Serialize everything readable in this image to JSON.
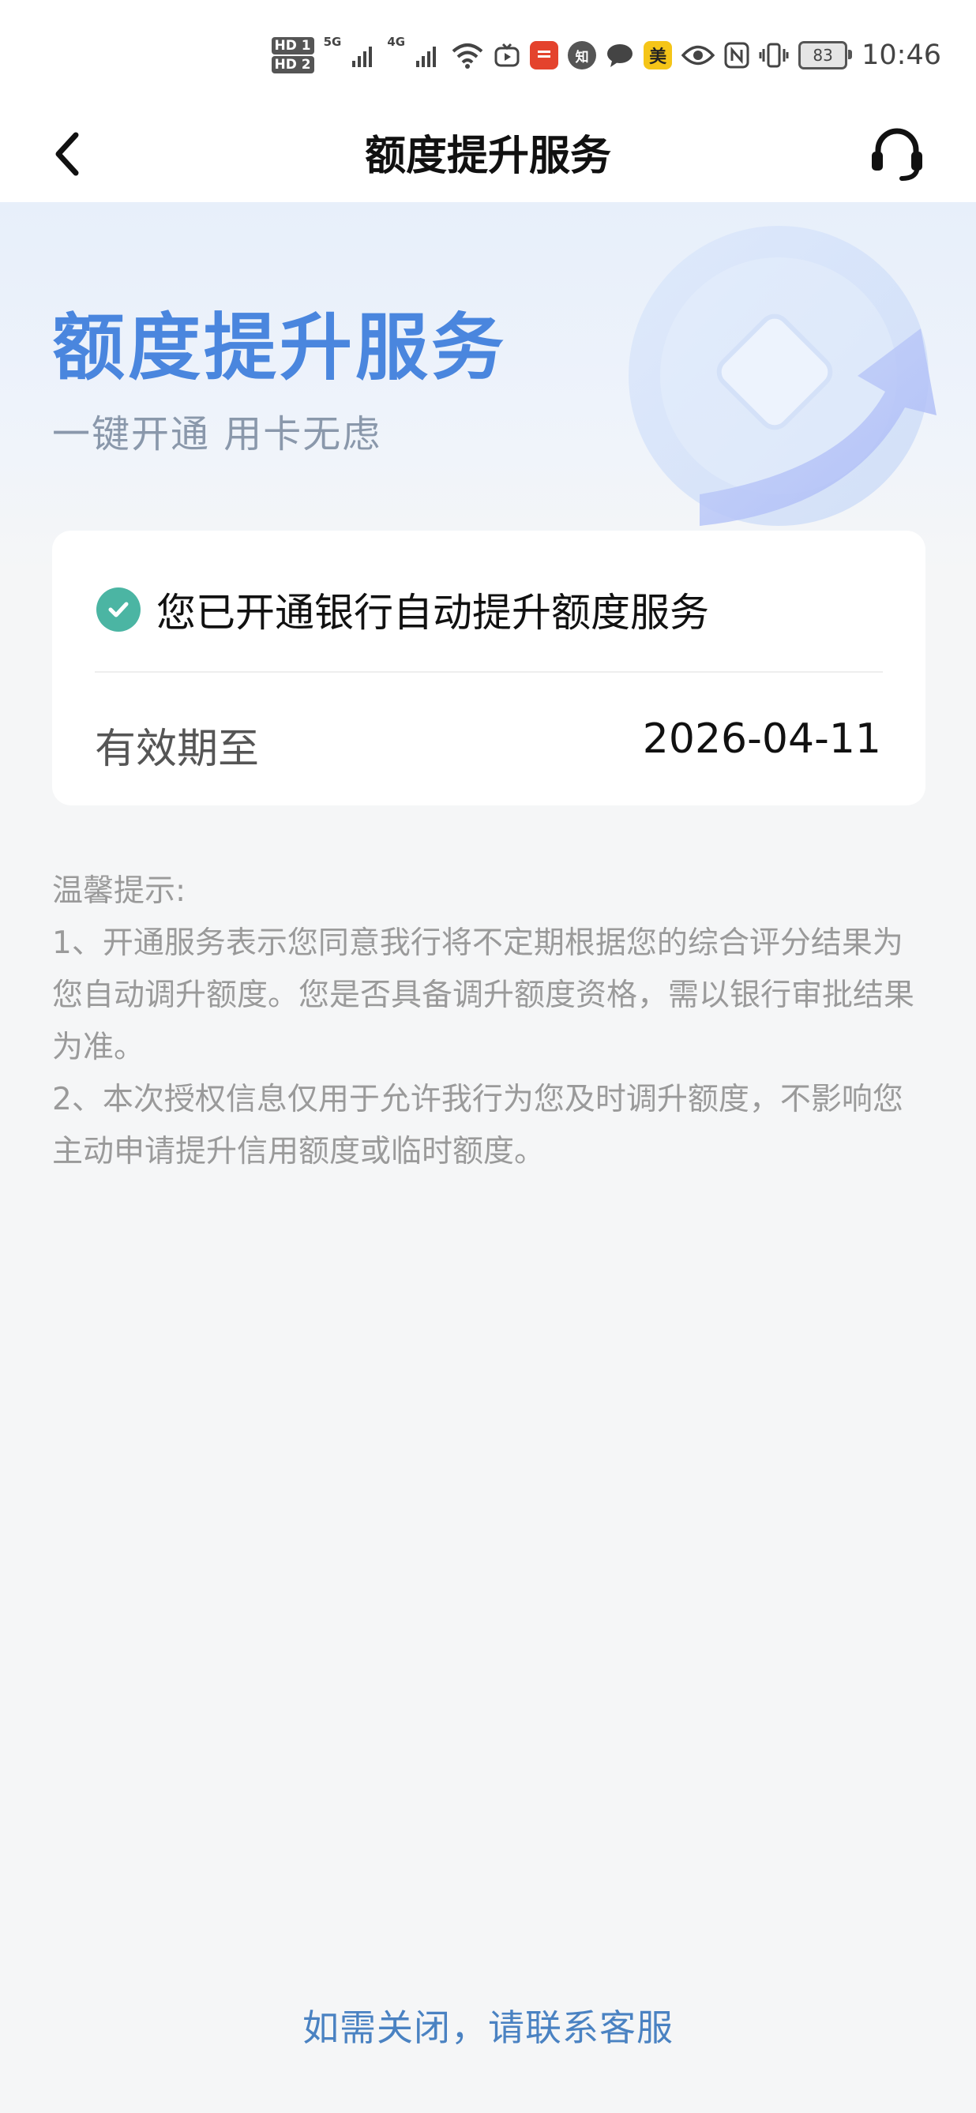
{
  "status_bar": {
    "hd1": "HD 1",
    "hd2": "HD 2",
    "net1": "5G",
    "net2": "4G",
    "battery": "83",
    "time": "10:46",
    "app_zhi": "知",
    "app_mei": "美"
  },
  "header": {
    "title": "额度提升服务"
  },
  "banner": {
    "title": "额度提升服务",
    "subtitle": "一键开通 用卡无虑"
  },
  "card": {
    "status_text": "您已开通银行自动提升额度服务",
    "validity_label": "有效期至",
    "validity_value": "2026-04-11"
  },
  "tips": {
    "heading": "温馨提示:",
    "item1": "1、开通服务表示您同意我行将不定期根据您的综合评分结果为您自动调升额度。您是否具备调升额度资格，需以银行审批结果为准。",
    "item2": "2、本次授权信息仅用于允许我行为您及时调升额度，不影响您主动申请提升信用额度或临时额度。"
  },
  "footer": {
    "close_link": "如需关闭，请联系客服"
  },
  "colors": {
    "accent": "#4a86de",
    "check": "#4bb5a3",
    "link": "#4a82c2"
  }
}
